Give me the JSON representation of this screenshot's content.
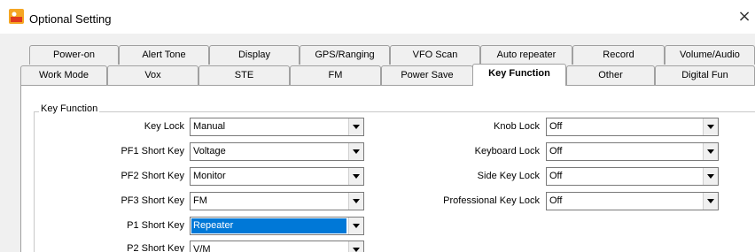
{
  "window": {
    "title": "Optional Setting",
    "close_glyph": "×"
  },
  "tabs_top": [
    "Power-on",
    "Alert Tone",
    "Display",
    "GPS/Ranging",
    "VFO Scan",
    "Auto repeater",
    "Record",
    "Volume/Audio"
  ],
  "tabs_bottom": [
    "Work Mode",
    "Vox",
    "STE",
    "FM",
    "Power Save",
    "Key Function",
    "Other",
    "Digital Fun"
  ],
  "active_tab": "Key Function",
  "group": {
    "title": "Key Function"
  },
  "left_fields": [
    {
      "label": "Key Lock",
      "value": "Manual"
    },
    {
      "label": "PF1 Short Key",
      "value": "Voltage"
    },
    {
      "label": "PF2 Short Key",
      "value": "Monitor"
    },
    {
      "label": "PF3 Short Key",
      "value": "FM"
    },
    {
      "label": "P1 Short Key",
      "value": "Repeater"
    },
    {
      "label": "P2 Short Key",
      "value": "V/M"
    }
  ],
  "right_fields": [
    {
      "label": "Knob Lock",
      "value": "Off"
    },
    {
      "label": "Keyboard Lock",
      "value": "Off"
    },
    {
      "label": "Side Key Lock",
      "value": "Off"
    },
    {
      "label": "Professional Key Lock",
      "value": "Off"
    }
  ],
  "colors": {
    "selection": "#0078d7",
    "dialog_bg": "#f0f0f0",
    "icon_orange": "#f5a623",
    "icon_red": "#e03a1e"
  }
}
